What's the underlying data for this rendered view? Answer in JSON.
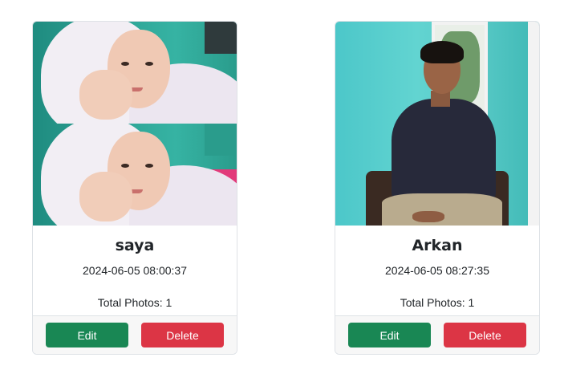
{
  "cards": [
    {
      "name": "saya",
      "timestamp": "2024-06-05 08:00:37",
      "total_photos": "Total Photos: 1",
      "edit_label": "Edit",
      "delete_label": "Delete"
    },
    {
      "name": "Arkan",
      "timestamp": "2024-06-05 08:27:35",
      "total_photos": "Total Photos: 1",
      "edit_label": "Edit",
      "delete_label": "Delete"
    }
  ],
  "colors": {
    "edit_button": "#198754",
    "delete_button": "#dc3545",
    "card_border": "#dee2e6",
    "footer_bg": "#f7f7f7"
  }
}
